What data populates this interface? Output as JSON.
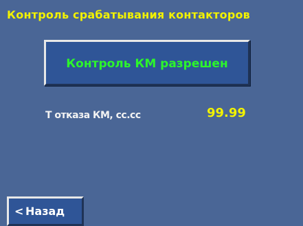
{
  "screen": {
    "title": "Контроль срабатывания контакторов",
    "control_button": {
      "label": "Контроль КМ разрешен"
    },
    "parameter": {
      "label": "Т отказа КМ, сс.сс",
      "value": "99.99"
    },
    "back_button": {
      "icon": "<",
      "label": "Назад"
    },
    "colors": {
      "background": "#4a6696",
      "title": "#f2f200",
      "button_fill": "#2f5597",
      "button_text": "#2cf52c",
      "value": "#f2f200"
    }
  }
}
